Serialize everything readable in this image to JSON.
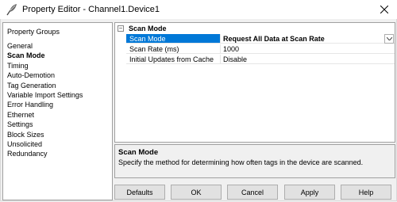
{
  "window": {
    "title": "Property Editor - Channel1.Device1"
  },
  "property_groups": {
    "header": "Property Groups",
    "items": [
      "General",
      "Scan Mode",
      "Timing",
      "Auto-Demotion",
      "Tag Generation",
      "Variable Import Settings",
      "Error Handling",
      "Ethernet",
      "Settings",
      "Block Sizes",
      "Unsolicited",
      "Redundancy"
    ],
    "selected": "Scan Mode"
  },
  "grid": {
    "section": "Scan Mode",
    "rows": [
      {
        "name": "Scan Mode",
        "value": "Request All Data at Scan Rate"
      },
      {
        "name": "Scan Rate (ms)",
        "value": "1000"
      },
      {
        "name": "Initial Updates from Cache",
        "value": "Disable"
      }
    ]
  },
  "description": {
    "title": "Scan Mode",
    "text": "Specify the method for determining how often tags in the device are scanned."
  },
  "buttons": {
    "defaults": "Defaults",
    "ok": "OK",
    "cancel": "Cancel",
    "apply": "Apply",
    "help": "Help"
  },
  "colors": {
    "selection": "#0078d7",
    "window_bg": "#f0f0f0"
  },
  "icons": {
    "app": "feather-icon",
    "close": "close-icon",
    "expander": "collapse-icon",
    "dropdown": "chevron-down-icon"
  }
}
